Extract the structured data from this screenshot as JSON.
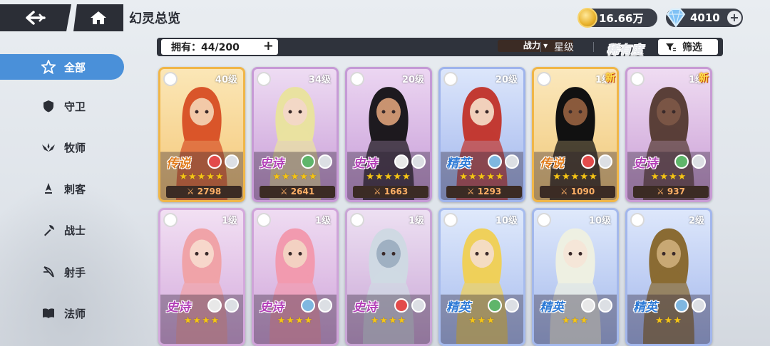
{
  "header": {
    "title": "幻灵总览"
  },
  "currency": {
    "gold": "16.66万",
    "gems": "4010"
  },
  "sidebar": {
    "items": [
      {
        "label": "全部",
        "icon": "star-icon",
        "active": true
      },
      {
        "label": "守卫",
        "icon": "shield-icon",
        "active": false
      },
      {
        "label": "牧师",
        "icon": "wings-icon",
        "active": false
      },
      {
        "label": "刺客",
        "icon": "dagger-icon",
        "active": false
      },
      {
        "label": "战士",
        "icon": "axe-icon",
        "active": false
      },
      {
        "label": "射手",
        "icon": "bow-icon",
        "active": false
      },
      {
        "label": "法师",
        "icon": "book-icon",
        "active": false
      }
    ]
  },
  "toolbar": {
    "owned": "拥有：44/200",
    "sort_power": "战力 ▾",
    "sort_star": "星级",
    "sort_rarity": "稀有度",
    "filter": "筛选"
  },
  "cards": [
    {
      "level": "40级",
      "rarity": "传说",
      "rarity_color": "#e07b1a",
      "stars": "★★★★★",
      "power": "⚔ 2798",
      "bg": [
        "#fbe7b7",
        "#f4c676"
      ],
      "skin": "#f2c9a8",
      "hair": "#d9552a",
      "frame": "#f0b648",
      "new": ""
    },
    {
      "level": "34级",
      "rarity": "史诗",
      "rarity_color": "#b33fb8",
      "stars": "★★★★★",
      "power": "⚔ 2641",
      "bg": [
        "#eedcf3",
        "#c79ad6"
      ],
      "skin": "#f3d8c6",
      "hair": "#e9e2a0",
      "frame": "#c79ad6",
      "new": ""
    },
    {
      "level": "20级",
      "rarity": "史诗",
      "rarity_color": "#b33fb8",
      "stars": "★★★★★",
      "power": "⚔ 1663",
      "bg": [
        "#ecd6f2",
        "#c59ad6"
      ],
      "skin": "#c99370",
      "hair": "#1d1a1f",
      "frame": "#c59ad6",
      "new": ""
    },
    {
      "level": "20级",
      "rarity": "精英",
      "rarity_color": "#2f7bd6",
      "stars": "★★★★★",
      "power": "⚔ 1293",
      "bg": [
        "#dce6fb",
        "#9fb4ec"
      ],
      "skin": "#f1d0bb",
      "hair": "#c23a33",
      "frame": "#9fb4ec",
      "new": ""
    },
    {
      "level": "1级",
      "rarity": "传说",
      "rarity_color": "#e07b1a",
      "stars": "★★★★★",
      "power": "⚔ 1090",
      "bg": [
        "#fbe8bd",
        "#f0c776"
      ],
      "skin": "#8a5a3c",
      "hair": "#111",
      "frame": "#f0b648",
      "new": "新"
    },
    {
      "level": "1级",
      "rarity": "史诗",
      "rarity_color": "#b33fb8",
      "stars": "★★★★",
      "power": "⚔ 937",
      "bg": [
        "#efdcf2",
        "#c89bd4"
      ],
      "skin": "#7a5545",
      "hair": "#5a3f38",
      "frame": "#c89bd4",
      "new": "新"
    },
    {
      "level": "1级",
      "rarity": "史诗",
      "rarity_color": "#b33fb8",
      "stars": "★★★★",
      "power": "",
      "bg": [
        "#f2e0f3",
        "#d3a8dc"
      ],
      "skin": "#f7d7cb",
      "hair": "#f0a3a8",
      "frame": "#d3a8dc",
      "new": ""
    },
    {
      "level": "1级",
      "rarity": "史诗",
      "rarity_color": "#b33fb8",
      "stars": "★★★★",
      "power": "",
      "bg": [
        "#efdcf2",
        "#cfa3d9"
      ],
      "skin": "#f3d1c2",
      "hair": "#f29aaf",
      "frame": "#cfa3d9",
      "new": ""
    },
    {
      "level": "1级",
      "rarity": "史诗",
      "rarity_color": "#b33fb8",
      "stars": "★★★★",
      "power": "",
      "bg": [
        "#ede0f2",
        "#c9a5d6"
      ],
      "skin": "#9fb0c2",
      "hair": "#cfd9e3",
      "frame": "#c9a5d6",
      "new": ""
    },
    {
      "level": "10级",
      "rarity": "精英",
      "rarity_color": "#2f7bd6",
      "stars": "★★★",
      "power": "",
      "bg": [
        "#dfe9fb",
        "#a6bbee"
      ],
      "skin": "#f4dcc2",
      "hair": "#efd05a",
      "frame": "#a6bbee",
      "new": ""
    },
    {
      "level": "10级",
      "rarity": "精英",
      "rarity_color": "#2f7bd6",
      "stars": "★★★",
      "power": "",
      "bg": [
        "#dfe9fb",
        "#a3b8ec"
      ],
      "skin": "#f5e6d8",
      "hair": "#eef0e2",
      "frame": "#a3b8ec",
      "new": ""
    },
    {
      "level": "2级",
      "rarity": "精英",
      "rarity_color": "#2f7bd6",
      "stars": "★★★",
      "power": "",
      "bg": [
        "#dde7fb",
        "#a2b6ec"
      ],
      "skin": "#c8a874",
      "hair": "#8a6b33",
      "frame": "#a2b6ec",
      "new": ""
    }
  ]
}
